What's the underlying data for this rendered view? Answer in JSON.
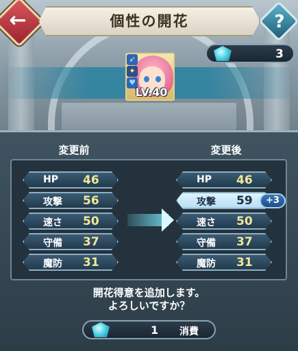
{
  "header": {
    "title": "個性の開花",
    "back_icon": "back-arrow-icon",
    "help_icon": "question-icon",
    "back_label": "←",
    "help_label": "?"
  },
  "currency": {
    "icon": "crystal-icon",
    "amount": "3"
  },
  "hero": {
    "level": "LV.40",
    "icons": [
      "weapon-icon",
      "move-icon",
      "flower-icon"
    ]
  },
  "columns": {
    "before": "変更前",
    "after": "変更後"
  },
  "stats_before": [
    {
      "label": "HP",
      "value": "46"
    },
    {
      "label": "攻撃",
      "value": "56"
    },
    {
      "label": "速さ",
      "value": "50"
    },
    {
      "label": "守備",
      "value": "37"
    },
    {
      "label": "魔防",
      "value": "31"
    }
  ],
  "stats_after": [
    {
      "label": "HP",
      "value": "46"
    },
    {
      "label": "攻撃",
      "value": "59"
    },
    {
      "label": "速さ",
      "value": "50"
    },
    {
      "label": "守備",
      "value": "37"
    },
    {
      "label": "魔防",
      "value": "31"
    }
  ],
  "bonus": "+3",
  "confirm": {
    "line1": "開花得意を追加します。",
    "line2": "よろしいですか？"
  },
  "cost": {
    "amount": "1",
    "label": "消費"
  }
}
